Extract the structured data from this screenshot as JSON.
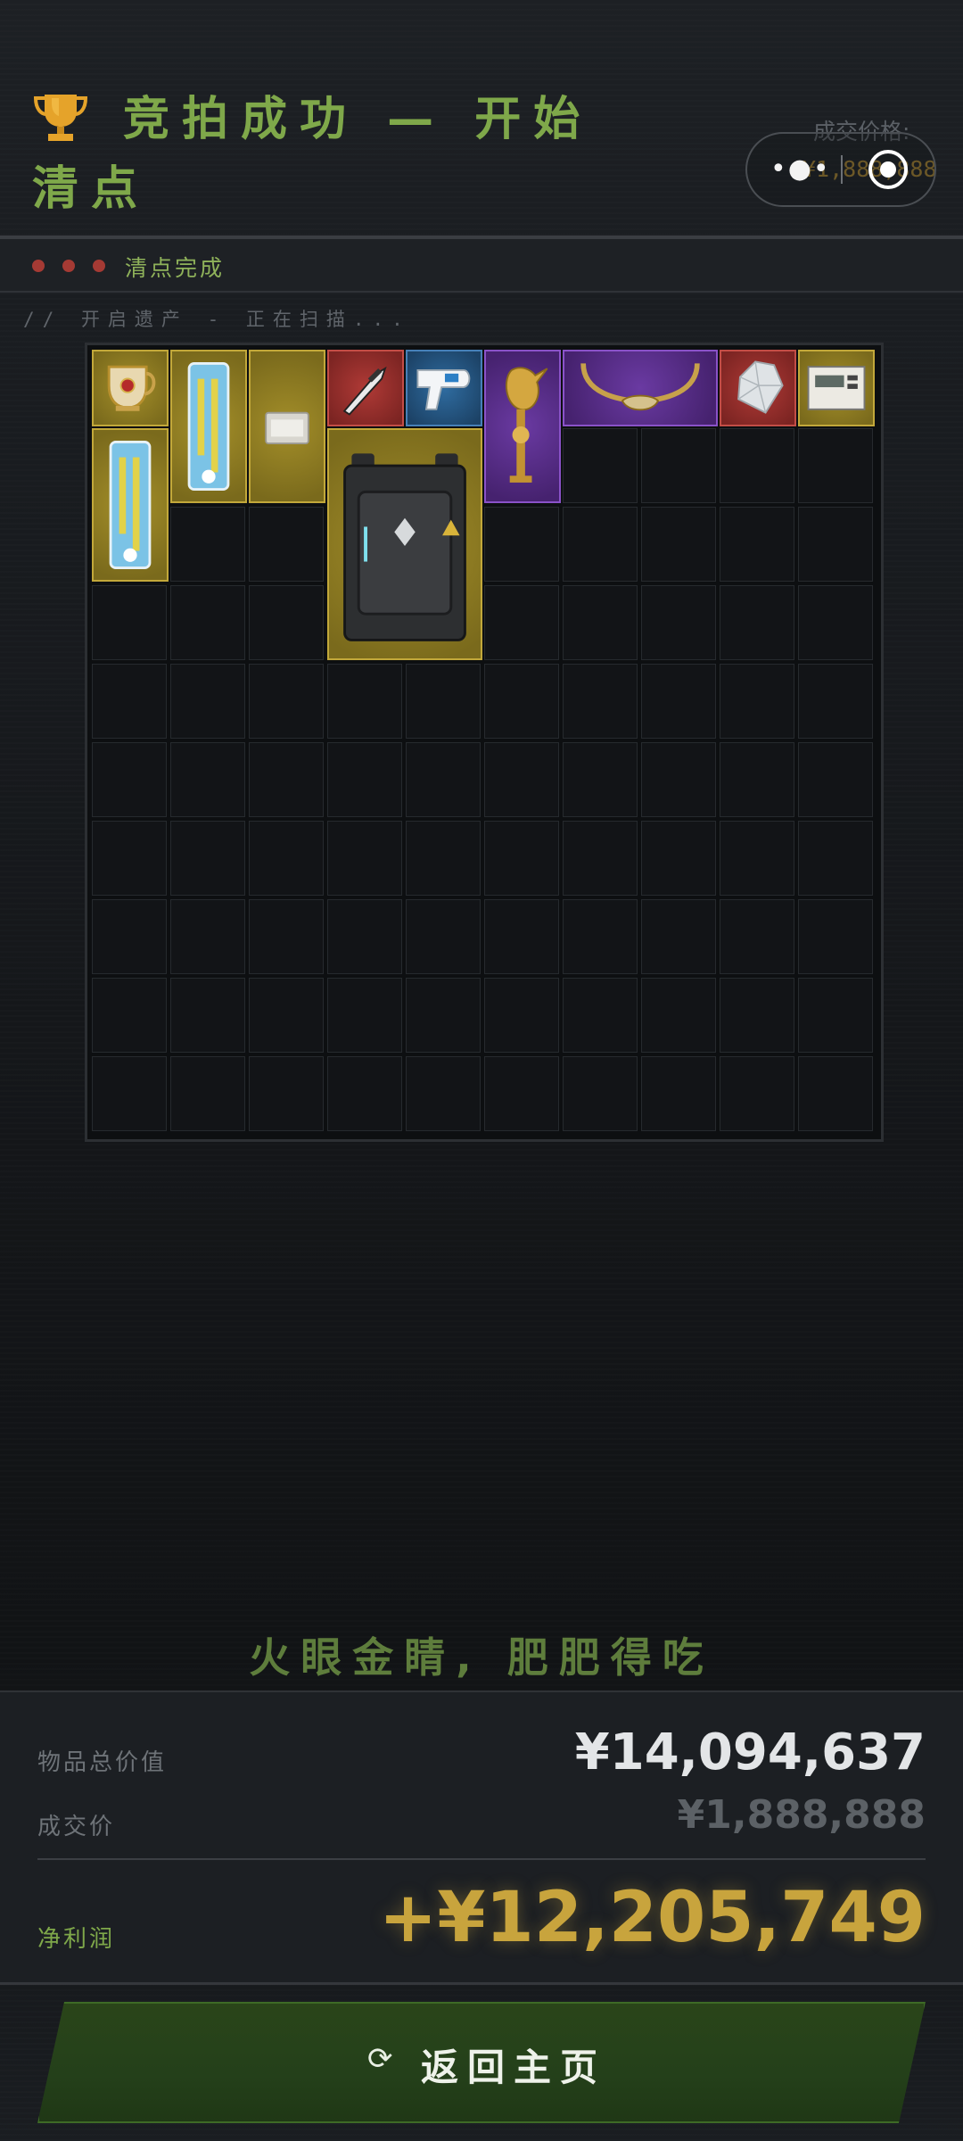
{
  "header": {
    "title": "竞拍成功 — 开始清点",
    "deal_label": "成交价格:",
    "deal_value": "¥1,888,888",
    "capsule": {
      "menu_icon": "more-dots-icon",
      "close_icon": "target-close-icon"
    }
  },
  "status": {
    "text": "清点完成",
    "dots_color": "#a53a34"
  },
  "scan": {
    "text": "// 开启遗产 - 正在扫描..."
  },
  "inventory": {
    "columns": 10,
    "rows": 10,
    "items": [
      {
        "name": "golden-goblet",
        "rarity": "gold"
      },
      {
        "name": "medical-kit-blue",
        "rarity": "gold"
      },
      {
        "name": "gas-tank",
        "rarity": "gold"
      },
      {
        "name": "scalpel",
        "rarity": "red"
      },
      {
        "name": "thermometer-gun",
        "rarity": "blue"
      },
      {
        "name": "gold-skull-statue",
        "rarity": "purple"
      },
      {
        "name": "bull-horn-necklace",
        "rarity": "purple"
      },
      {
        "name": "diamond",
        "rarity": "red"
      },
      {
        "name": "smart-meter",
        "rarity": "gold"
      },
      {
        "name": "medical-kit-blue-2",
        "rarity": "gold"
      },
      {
        "name": "tactical-case",
        "rarity": "gold"
      }
    ]
  },
  "slogan": "火眼金睛, 肥肥得吃",
  "summary": {
    "total_label": "物品总价值",
    "total_value": "¥14,094,637",
    "deal_label": "成交价",
    "deal_value": "¥1,888,888",
    "profit_label": "净利润",
    "profit_value": "+¥12,205,749"
  },
  "button": {
    "label": "返回主页",
    "icon": "refresh-icon"
  },
  "colors": {
    "accent_green": "#7fa84a",
    "gold": "#c8a43d"
  }
}
